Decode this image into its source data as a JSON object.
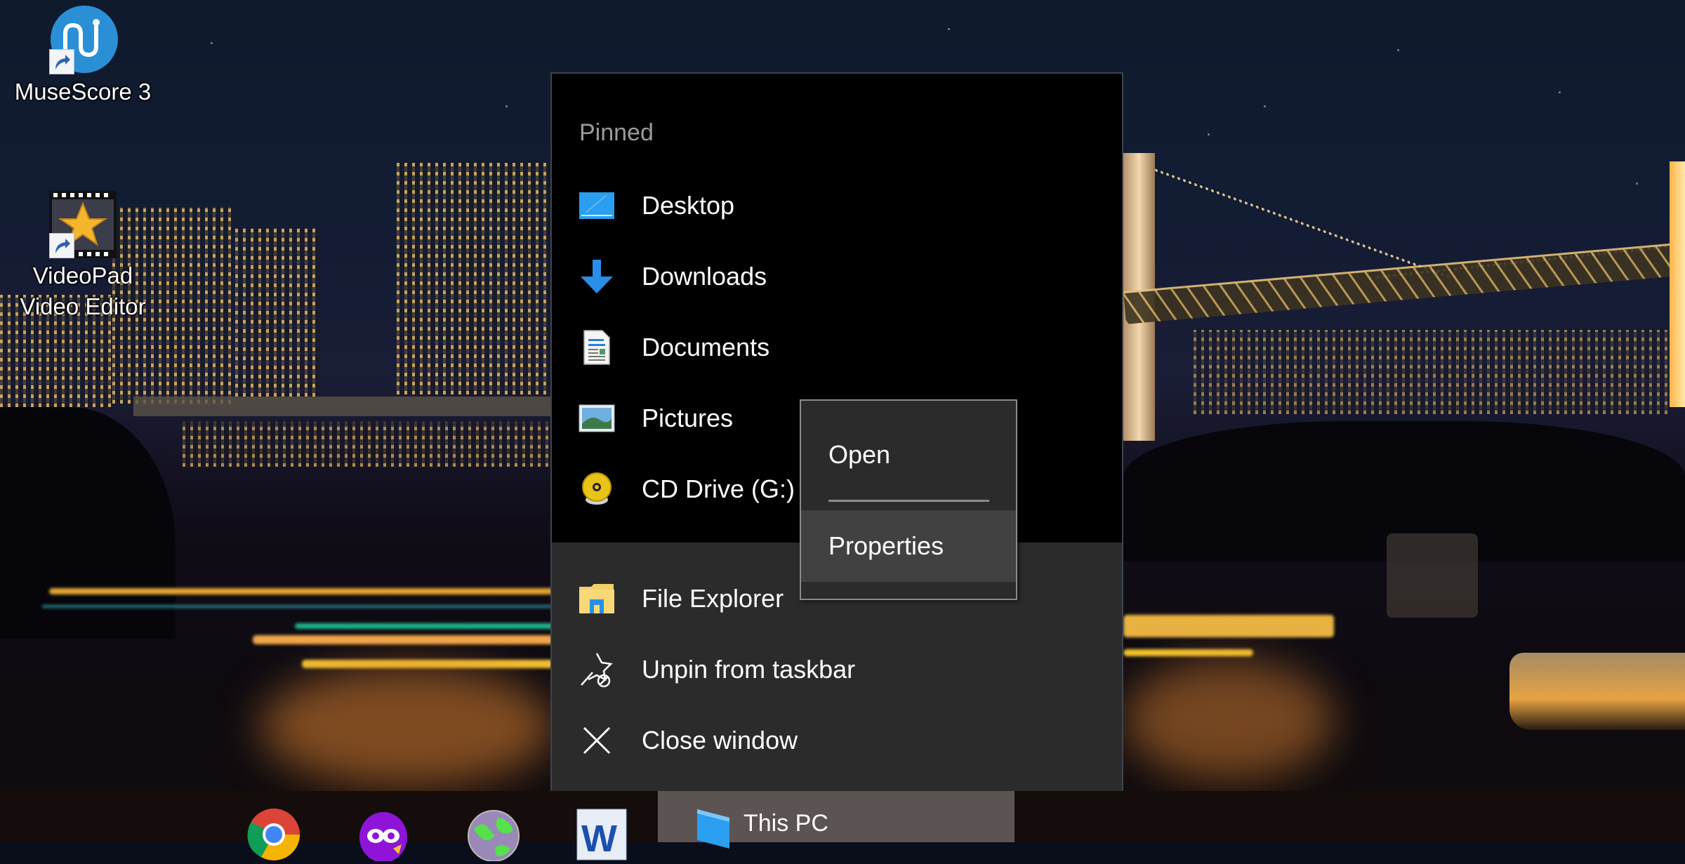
{
  "desktop": {
    "icons": [
      {
        "label": "MuseScore 3",
        "icon": "musescore-icon"
      },
      {
        "label_line1": "VideoPad",
        "label_line2": "Video Editor",
        "icon": "videopad-icon"
      }
    ]
  },
  "jumplist": {
    "heading": "Pinned",
    "pinned": [
      {
        "label": "Desktop",
        "icon": "desktop-folder-icon"
      },
      {
        "label": "Downloads",
        "icon": "downloads-arrow-icon"
      },
      {
        "label": "Documents",
        "icon": "documents-icon"
      },
      {
        "label": "Pictures",
        "icon": "pictures-icon"
      },
      {
        "label": "CD Drive (G:)",
        "icon": "cd-drive-icon"
      }
    ],
    "tasks": [
      {
        "label": "File Explorer",
        "icon": "file-explorer-icon"
      },
      {
        "label": "Unpin from taskbar",
        "icon": "unpin-icon"
      },
      {
        "label": "Close window",
        "icon": "close-icon"
      }
    ]
  },
  "context_menu": {
    "items": [
      {
        "label": "Open"
      },
      {
        "label": "Properties",
        "highlighted": true
      }
    ]
  },
  "taskbar": {
    "pinned_apps": [
      {
        "name": "Google Chrome",
        "icon": "chrome-icon"
      },
      {
        "name": "Owl app",
        "icon": "owl-icon"
      },
      {
        "name": "Globe app",
        "icon": "globe-icon"
      },
      {
        "name": "Microsoft Word",
        "icon": "word-icon"
      }
    ],
    "active_window": {
      "label": "This PC",
      "icon": "this-pc-icon"
    }
  },
  "colors": {
    "accent_blue": "#2a9ef0",
    "jumplist_top_bg": "#000000",
    "jumplist_bottom_bg": "#2b2b2b",
    "context_highlight": "#414141",
    "taskbar_bg": "#140d0c",
    "active_window_bg": "#5c5452"
  }
}
